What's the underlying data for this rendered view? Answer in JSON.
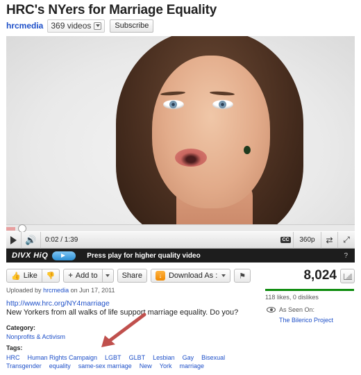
{
  "video": {
    "title": "HRC's NYers for Marriage Equality"
  },
  "channel": {
    "name": "hrcmedia",
    "videos_count": "369 videos",
    "subscribe_label": "Subscribe"
  },
  "player": {
    "progress": 0.025,
    "timecode": "0:02 / 1:39",
    "cc_label": "CC",
    "quality": "360p"
  },
  "divx": {
    "logo": "DIVX HiQ",
    "message": "Press play for higher quality video",
    "help": "?"
  },
  "actions": {
    "like_label": "Like",
    "add_to_label": "Add to",
    "share_label": "Share",
    "download_label": "Download As :"
  },
  "stats": {
    "views": "8,024",
    "likes_text": "118 likes, 0 dislikes",
    "like_ratio": 1.0
  },
  "info": {
    "uploaded_prefix": "Uploaded by",
    "uploader": "hrcmedia",
    "uploaded_date": "on Jun 17, 2011",
    "url": "http://www.hrc.org/NY4marriage",
    "description": "New Yorkers from all walks of life support marriage equality. Do you?"
  },
  "seen_on": {
    "label": "As Seen On:",
    "site": "The Bilerico Project"
  },
  "category": {
    "label": "Category:",
    "value": "Nonprofits & Activism"
  },
  "tags": {
    "label": "Tags:",
    "row1": [
      "HRC",
      "Human Rights Campaign",
      "LGBT",
      "GLBT",
      "Lesbian",
      "Gay",
      "Bisexual"
    ],
    "row2": [
      "Transgender",
      "equality",
      "same-sex marriage",
      "New",
      "York",
      "marriage"
    ]
  },
  "colors": {
    "link": "#1d4fc8",
    "like_bar": "#0a8a0a",
    "annotation_arrow": "#c0504d",
    "divx_bar": "#1d1d1d"
  }
}
